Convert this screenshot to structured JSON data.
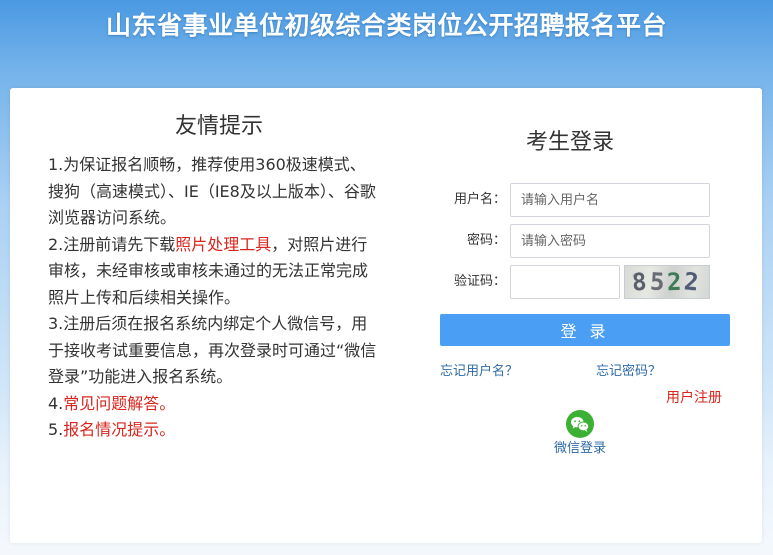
{
  "header": {
    "title": "山东省事业单位初级综合类岗位公开招聘报名平台"
  },
  "tips": {
    "title": "友情提示",
    "item1": "1.为保证报名顺畅，推荐使用360极速模式、搜狗（高速模式）、IE（IE8及以上版本）、谷歌浏览器访问系统。",
    "item2_before": "2.注册前请先下载",
    "item2_link": "照片处理工具",
    "item2_after": "，对照片进行审核，未经审核或审核未通过的无法正常完成照片上传和后续相关操作。",
    "item3": "3.注册后须在报名系统内绑定个人微信号，用于接收考试重要信息，再次登录时可通过“微信登录”功能进入报名系统。",
    "item4_prefix": "4.",
    "item4_link": "常见问题解答。",
    "item5_prefix": "5.",
    "item5_link": "报名情况提示。"
  },
  "login": {
    "title": "考生登录",
    "username_label": "用户名：",
    "username_placeholder": "请输入用户名",
    "password_label": "密码：",
    "password_placeholder": "请输入密码",
    "captcha_label": "验证码：",
    "captcha_value": "",
    "captcha_chars": [
      "8",
      "5",
      "2",
      "2"
    ],
    "submit_label": "登 录",
    "forgot_username": "忘记用户名？",
    "forgot_password": "忘记密码？",
    "register": "用户注册",
    "wechat_login": "微信登录"
  },
  "colors": {
    "accent": "#4a9ff5",
    "link": "#2e6aa8",
    "alert_red": "#d9251d",
    "wechat_green": "#3cb034"
  }
}
